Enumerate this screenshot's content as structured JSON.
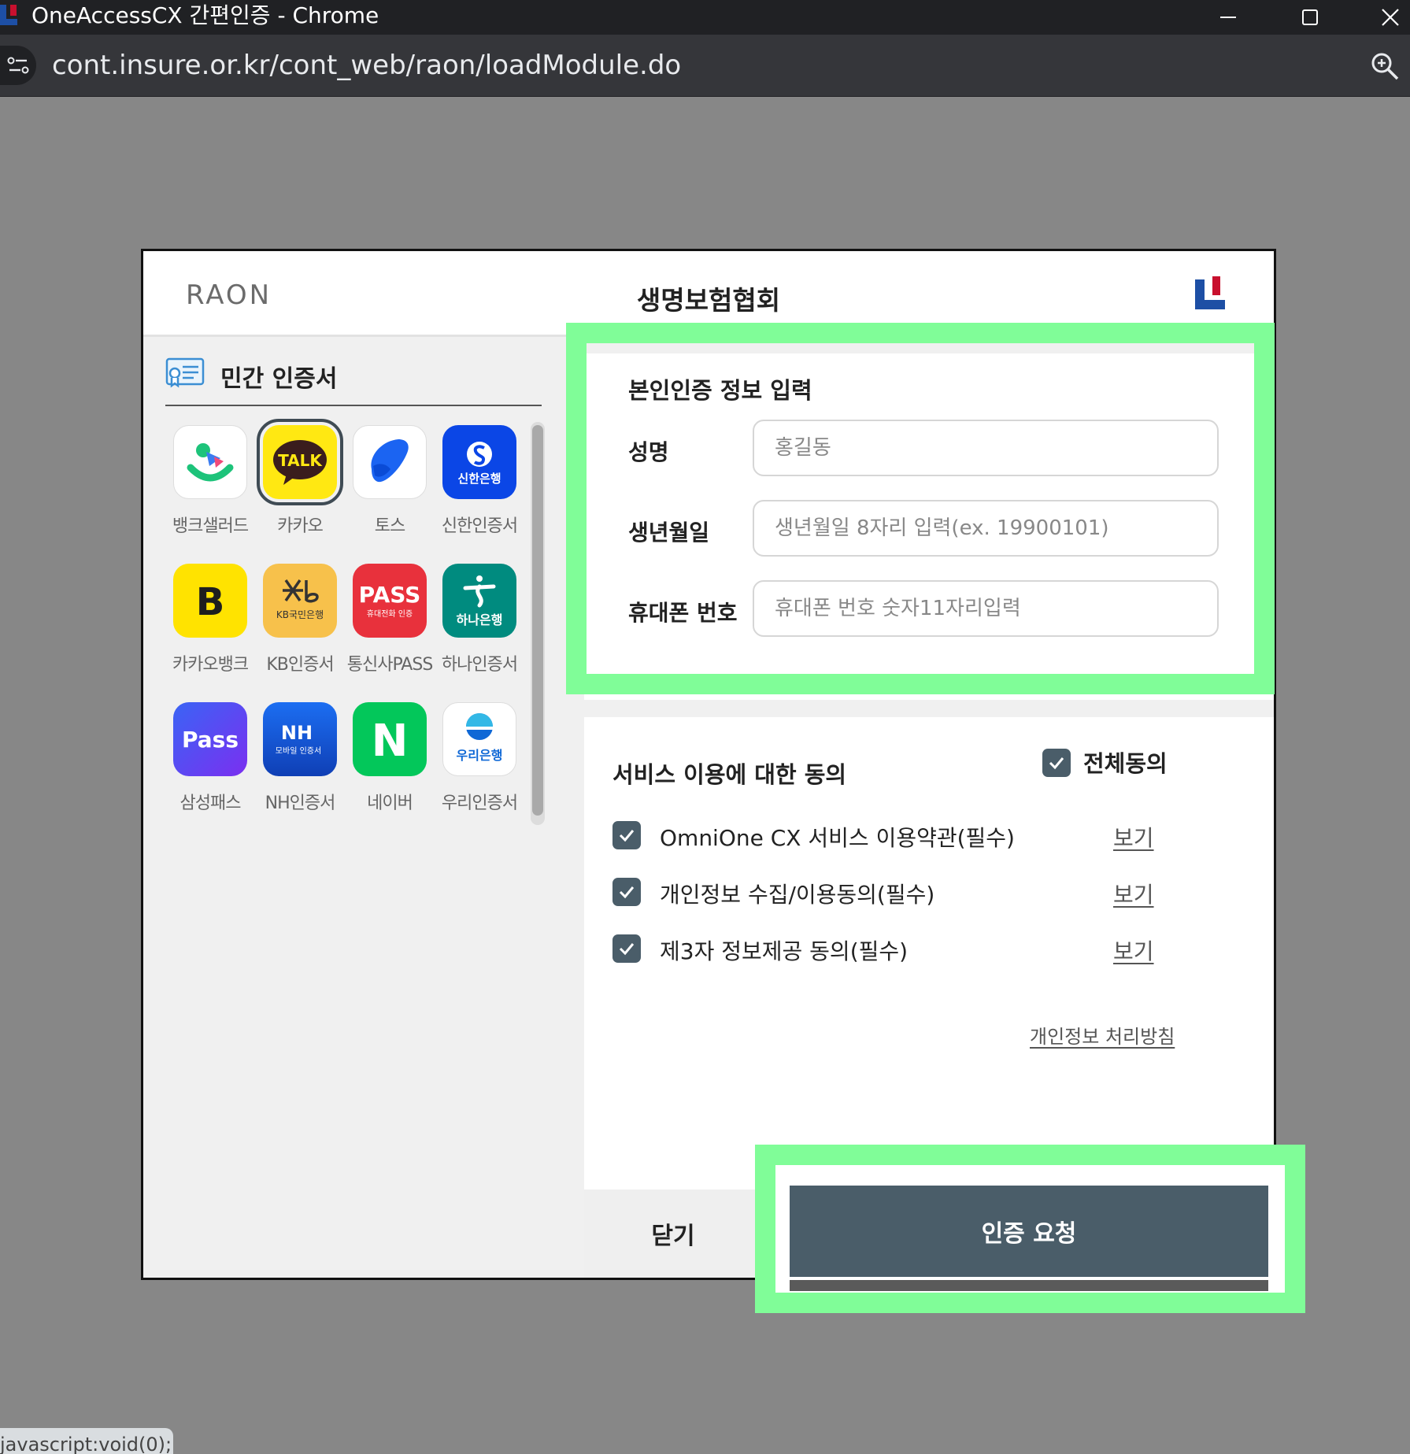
{
  "window": {
    "title": "OneAccessCX 간편인증 - Chrome",
    "url": "cont.insure.or.kr/cont_web/raon/loadModule.do",
    "icons": [
      "minimize-icon",
      "maximize-icon",
      "close-icon",
      "site-info-icon",
      "zoom-icon"
    ]
  },
  "dialog": {
    "brand_logo": "RAON",
    "title": "생명보험협회",
    "cert_section_title": "민간 인증서",
    "providers": [
      {
        "label": "뱅크샐러드",
        "badge": ""
      },
      {
        "label": "카카오",
        "badge": "TALK"
      },
      {
        "label": "토스",
        "badge": ""
      },
      {
        "label": "신한인증서",
        "badge": "신한은행"
      },
      {
        "label": "카카오뱅크",
        "badge": "B"
      },
      {
        "label": "KB인증서",
        "badge": "KB국민은행"
      },
      {
        "label": "통신사PASS",
        "badge": "PASS",
        "badge_sub": "휴대전화 인증"
      },
      {
        "label": "하나인증서",
        "badge": "하나은행"
      },
      {
        "label": "삼성패스",
        "badge": "Pass"
      },
      {
        "label": "NH인증서",
        "badge": "NH",
        "badge_sub": "모바일 인증서"
      },
      {
        "label": "네이버",
        "badge": "N"
      },
      {
        "label": "우리인증서",
        "badge": "우리은행"
      }
    ],
    "selected_provider": "카카오",
    "identity": {
      "title": "본인인증 정보 입력",
      "name_label": "성명",
      "name_placeholder": "홍길동",
      "birth_label": "생년월일",
      "birth_placeholder": "생년월일 8자리 입력(ex. 19900101)",
      "phone_label": "휴대폰 번호",
      "phone_placeholder": "휴대폰 번호 숫자11자리입력"
    },
    "consent": {
      "title": "서비스 이용에 대한 동의",
      "all_agree": "전체동의",
      "terms": [
        {
          "text": "OmniOne CX 서비스 이용약관(필수)",
          "link": "보기",
          "checked": true
        },
        {
          "text": "개인정보 수집/이용동의(필수)",
          "link": "보기",
          "checked": true
        },
        {
          "text": "제3자 정보제공 동의(필수)",
          "link": "보기",
          "checked": true
        }
      ],
      "policy_link": "개인정보 처리방침"
    },
    "close_button": "닫기",
    "submit_button": "인증 요청"
  },
  "status_bar": "javascript:void(0);",
  "colors": {
    "highlight": "#80fd98",
    "button_dark": "#4a5d69",
    "kakao_yellow": "#ffe812",
    "backdrop": "#878787"
  }
}
